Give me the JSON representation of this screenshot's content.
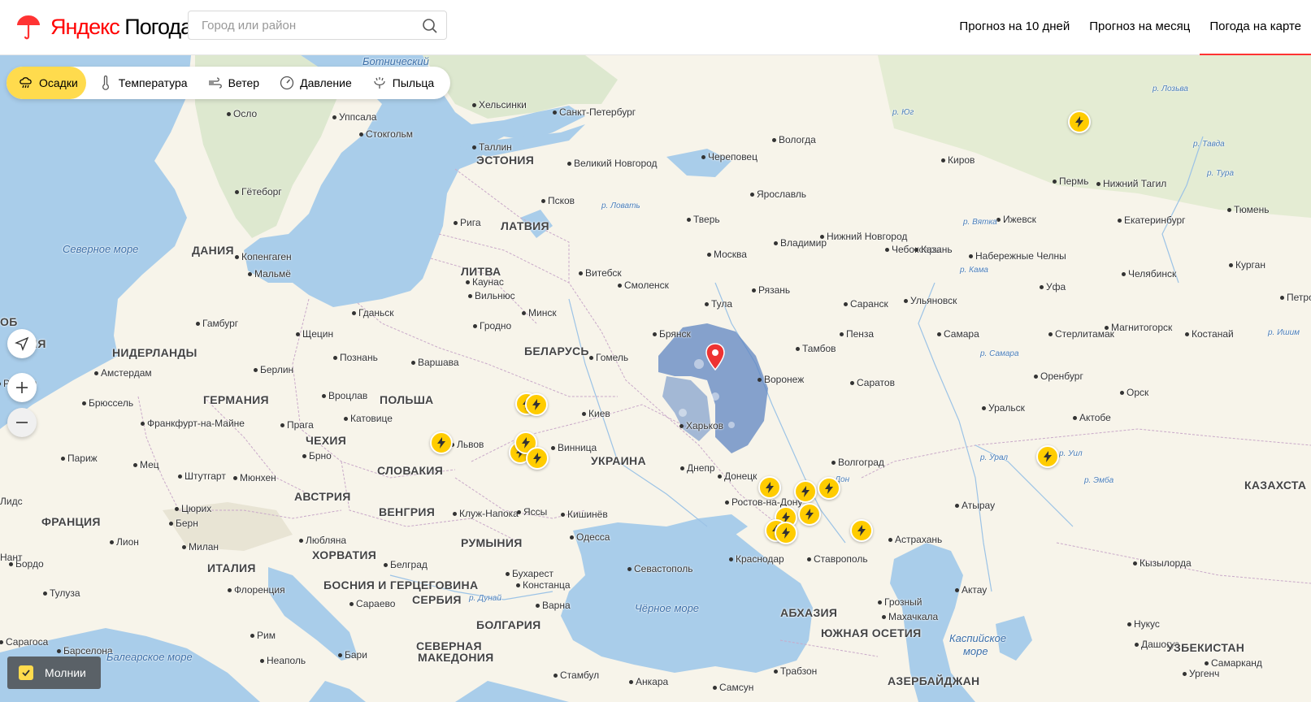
{
  "header": {
    "logo": "Яндекс Погода",
    "logo_ya": "Яндекс",
    "logo_rest": " Погода",
    "search_placeholder": "Город или район",
    "nav": [
      "Прогноз на 10 дней",
      "Прогноз на месяц",
      "Погода на карте"
    ],
    "active_nav": "Погода на карте"
  },
  "layers": {
    "active": "Осадки",
    "items": [
      "Осадки",
      "Температура",
      "Ветер",
      "Давление",
      "Пыльца"
    ]
  },
  "toggle": {
    "label": "Молнии",
    "checked": true
  },
  "map": {
    "countries": [
      "ЭСТОНИЯ",
      "ЛАТВИЯ",
      "ЛИТВА",
      "ДАНИЯ",
      "НИДЕРЛАНДЫ",
      "ГЕРМАНИЯ",
      "ПОЛЬША",
      "БЕЛАРУСЬ",
      "УКРАИНА",
      "ЧЕХИЯ",
      "СЛОВАКИЯ",
      "АВСТРИЯ",
      "ВЕНГРИЯ",
      "РУМЫНИЯ",
      "ФРАНЦИЯ",
      "ИТАЛИЯ",
      "ХОРВАТИЯ",
      "БОСНИЯ И ГЕРЦЕГОВИНА",
      "СЕРБИЯ",
      "БОЛГАРИЯ",
      "СЕВЕРНАЯ",
      "МАКЕДОНИЯ",
      "КАЗАХСТА",
      "УЗБЕКИСТАН",
      "АБХАЗИЯ",
      "ЮЖНАЯ ОСЕТИЯ",
      "АЗЕРБАЙДЖАН",
      "ИЯ",
      "ОБ"
    ],
    "seas": [
      "Ботнический",
      "Северное море",
      "Балеарское море",
      "Чёрное море",
      "Каспийское",
      "море"
    ],
    "rivers": [
      "р. Юг",
      "р. Ловать",
      "р. Вятка",
      "р. Кама",
      "р. Самара",
      "р. Урал",
      "р. Уил",
      "р. Эмба",
      "р. Дунай",
      "р. Лозьва",
      "р. Тавда",
      "р. Тура",
      "р. Ишим",
      "Дон"
    ],
    "cities": [
      "Хельсинки",
      "Санкт-Петербург",
      "Вологда",
      "Осло",
      "Уппсала",
      "Стокгольм",
      "Таллин",
      "Череповец",
      "Великий Новгород",
      "Киров",
      "Пермь",
      "Нижний Тагил",
      "Гётеборг",
      "Псков",
      "Ярославль",
      "Ижевск",
      "Екатеринбург",
      "Тюмень",
      "Рига",
      "Тверь",
      "Нижний Новгород",
      "Чебоксары",
      "Казань",
      "Набережные Челны",
      "Копенгаген",
      "Мальмё",
      "Москва",
      "Владимир",
      "Витебск",
      "Смоленск",
      "Курган",
      "Каунас",
      "Вильнюс",
      "Рязань",
      "Саранск",
      "Ульяновск",
      "Уфа",
      "Челябинск",
      "Гамбург",
      "Гданьск",
      "Минск",
      "Тула",
      "Щецин",
      "Гродно",
      "Брянск",
      "Пенза",
      "Самара",
      "Стерлитамак",
      "Магнитогорск",
      "Костанай",
      "Амстердам",
      "Берлин",
      "Познань",
      "Варшава",
      "Гомель",
      "Тамбов",
      "Воронеж",
      "Саратов",
      "Оренбург",
      "Брюссель",
      "Вроцлав",
      "Орск",
      "Уральск",
      "Актобе",
      "Франкфурт-на-Майне",
      "Катовице",
      "Прага",
      "Киев",
      "Харьков",
      "Львов",
      "Брно",
      "Винница",
      "Париж",
      "Мец",
      "Штутгарт",
      "Мюнхен",
      "Днепр",
      "Волгоград",
      "Донецк",
      "Ростов-на-Дону",
      "Атырау",
      "Цюрих",
      "Кишинёв",
      "Клуж-Напока",
      "Берн",
      "Ясcы",
      "Одесса",
      "Лион",
      "Любляна",
      "Милан",
      "Белград",
      "Краснодар",
      "Ставрополь",
      "Астрахань",
      "Кызылорда",
      "Бордо",
      "Бухарест",
      "Севастополь",
      "Констанца",
      "Тулуза",
      "Флоренция",
      "Сарaево",
      "Варна",
      "Актау",
      "Грозный",
      "Махачкала",
      "Нукус",
      "Рим",
      "Сарагоса",
      "Барселона",
      "Неаполь",
      "Бари",
      "Дашогуз",
      "Стамбул",
      "Самсун",
      "Трабзон",
      "Анкара",
      "Лидс",
      "Рондон",
      "Нант",
      "Петро",
      "Ургенч",
      "Самарканд"
    ],
    "location_pin": "current-location",
    "lightning_count": 16
  }
}
